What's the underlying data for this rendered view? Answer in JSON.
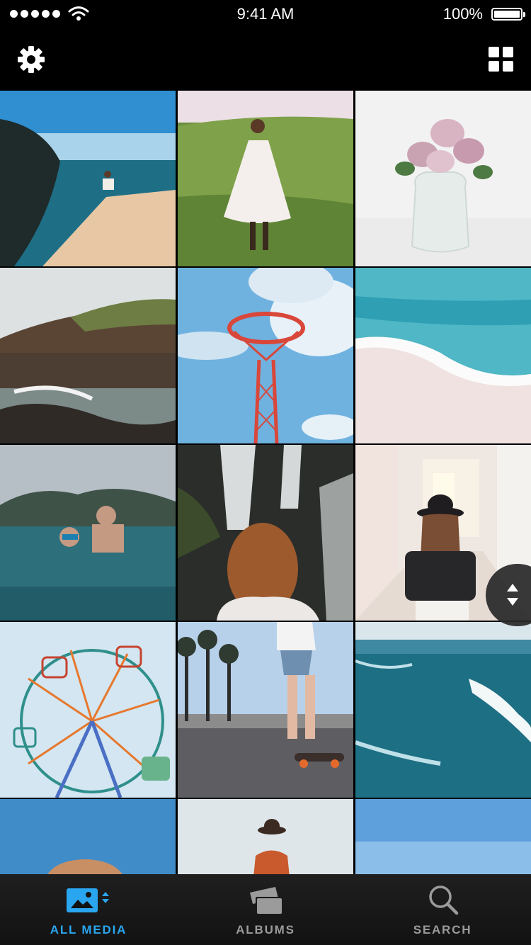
{
  "status_bar": {
    "time": "9:41 AM",
    "battery": "100%",
    "battery_level": 1.0,
    "signal_bars": 5
  },
  "nav_bar": {
    "left_icon": "gear-icon",
    "right_icon": "grid-view-icon"
  },
  "photos": [
    "cliff-over-ocean",
    "girl-in-white-dress-field",
    "pink-roses-vase",
    "rocky-coastline",
    "red-tower-sky",
    "sea-foam-beach",
    "couple-snorkeling",
    "girl-at-waterfall",
    "woman-in-hat-hallway",
    "ferris-wheel",
    "skateboarder-palms",
    "aerial-surf-waves",
    "hat-blue-sky",
    "woman-hat-horizon",
    "clear-blue-sky"
  ],
  "tabs": [
    {
      "label": "ALL MEDIA",
      "icon": "photo-icon",
      "active": true
    },
    {
      "label": "ALBUMS",
      "icon": "albums-icon",
      "active": false
    },
    {
      "label": "SEARCH",
      "icon": "search-icon",
      "active": false
    }
  ],
  "colors": {
    "accent": "#2aa6f0",
    "inactive": "#9b9b9b",
    "background": "#000000"
  }
}
